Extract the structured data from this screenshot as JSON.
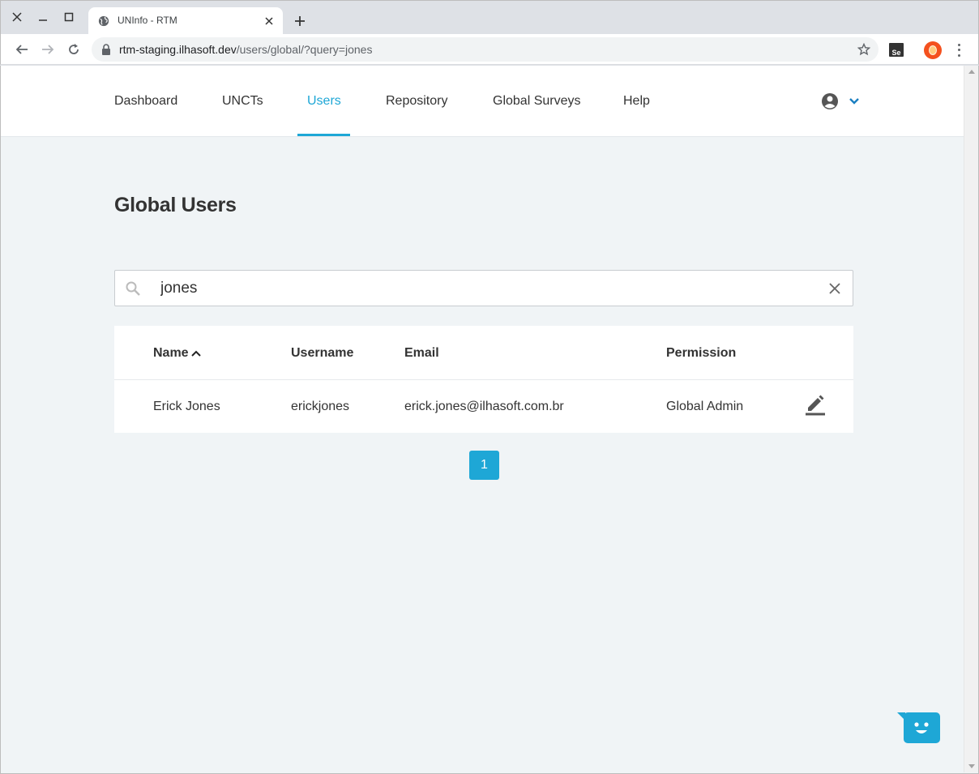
{
  "browser": {
    "tab_title": "UNInfo - RTM",
    "url_host": "rtm-staging.ilhasoft.dev",
    "url_path": "/users/global/?query=jones",
    "extension_label": "Se"
  },
  "nav": {
    "items": [
      {
        "label": "Dashboard",
        "active": false
      },
      {
        "label": "UNCTs",
        "active": false
      },
      {
        "label": "Users",
        "active": true
      },
      {
        "label": "Repository",
        "active": false
      },
      {
        "label": "Global Surveys",
        "active": false
      },
      {
        "label": "Help",
        "active": false
      }
    ]
  },
  "page": {
    "title": "Global Users"
  },
  "search": {
    "value": "jones",
    "placeholder": ""
  },
  "table": {
    "columns": [
      "Name",
      "Username",
      "Email",
      "Permission"
    ],
    "sorted_column": "Name",
    "sort_direction": "ascending",
    "rows": [
      {
        "name": "Erick Jones",
        "username": "erickjones",
        "email": "erick.jones@ilhasoft.com.br",
        "permission": "Global Admin"
      }
    ]
  },
  "pagination": {
    "current_page": "1"
  },
  "colors": {
    "accent": "#1ea7d6",
    "background": "#f0f4f6",
    "text": "#333333"
  }
}
